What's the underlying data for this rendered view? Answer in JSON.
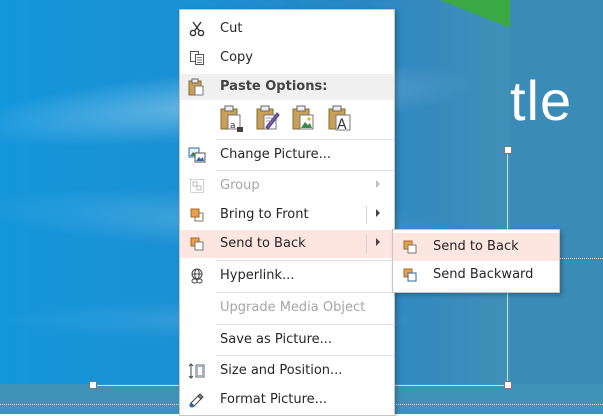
{
  "slide": {
    "title_partial": "tle",
    "colors": {
      "background": "#1597dc",
      "panel": "#3a8bb5",
      "accent_green": "#3aa843"
    }
  },
  "context_menu": {
    "cut": {
      "label": "Cut",
      "icon": "scissors-icon"
    },
    "copy": {
      "label": "Copy",
      "icon": "copy-icon"
    },
    "paste_options": {
      "label": "Paste Options:",
      "icon": "clipboard-icon",
      "buttons": [
        {
          "name": "paste-use-destination-theme",
          "icon": "paste-destination-theme-icon"
        },
        {
          "name": "paste-keep-source-formatting",
          "icon": "paste-keep-source-icon"
        },
        {
          "name": "paste-picture",
          "icon": "paste-picture-icon"
        },
        {
          "name": "paste-keep-text-only",
          "icon": "paste-text-only-icon"
        }
      ]
    },
    "change_picture": {
      "label": "Change Picture...",
      "icon": "change-picture-icon"
    },
    "group": {
      "label": "Group",
      "icon": "group-icon",
      "disabled": true
    },
    "bring_to_front": {
      "label": "Bring to Front",
      "icon": "bring-to-front-icon"
    },
    "send_to_back": {
      "label": "Send to Back",
      "icon": "send-to-back-icon",
      "highlighted": true
    },
    "hyperlink": {
      "label": "Hyperlink...",
      "icon": "hyperlink-icon"
    },
    "upgrade_media": {
      "label": "Upgrade Media Object",
      "disabled": true
    },
    "save_as_picture": {
      "label": "Save as Picture..."
    },
    "size_and_position": {
      "label": "Size and Position...",
      "icon": "size-position-icon"
    },
    "format_picture": {
      "label": "Format Picture...",
      "icon": "format-picture-icon"
    },
    "highlight_color": "#fde5e0"
  },
  "submenu": {
    "send_to_back": {
      "label": "Send to Back",
      "icon": "send-to-back-icon",
      "highlighted": true
    },
    "send_backward": {
      "label": "Send Backward",
      "icon": "send-backward-icon"
    }
  }
}
